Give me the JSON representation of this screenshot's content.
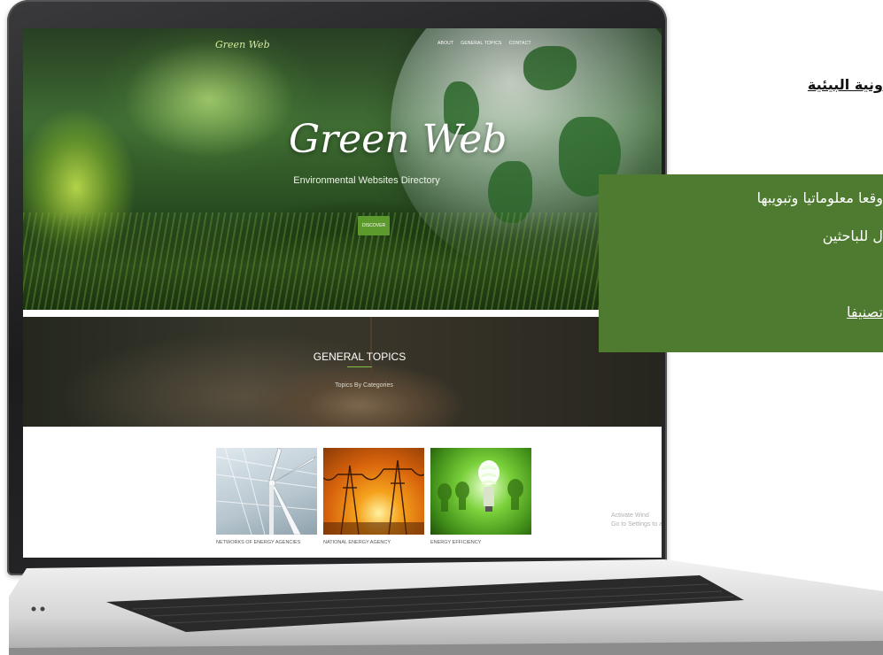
{
  "site": {
    "brand": "Green Web",
    "nav": [
      "ABOUT",
      "GENERAL TOPICS",
      "CONTACT"
    ],
    "hero_title": "Green Web",
    "hero_subtitle": "Environmental Websites Directory",
    "discover_label": "DISCOVER",
    "topics_title": "GENERAL TOPICS",
    "topics_subtitle": "Topics By Categories",
    "cards": [
      {
        "label": "NETWORKS OF ENERGY AGENCIES",
        "icon": "wind-turbine-image"
      },
      {
        "label": "NATIONAL ENERGY AGENCY",
        "icon": "power-pylons-image"
      },
      {
        "label": "ENERGY EFFICIENCY",
        "icon": "light-bulb-image"
      }
    ],
    "watermark_line1": "Activate Wind",
    "watermark_line2": "Go to Settings to a"
  },
  "side": {
    "heading": "ونية البيئية",
    "line1": "وقعا معلوماتيا وتبويبها",
    "line2": "ل للباحثين",
    "link": "تصنيفا"
  },
  "colors": {
    "accent_green": "#5d9a2e",
    "panel_green": "#4e7b2f",
    "laptop_frame": "#2c2c2e"
  }
}
